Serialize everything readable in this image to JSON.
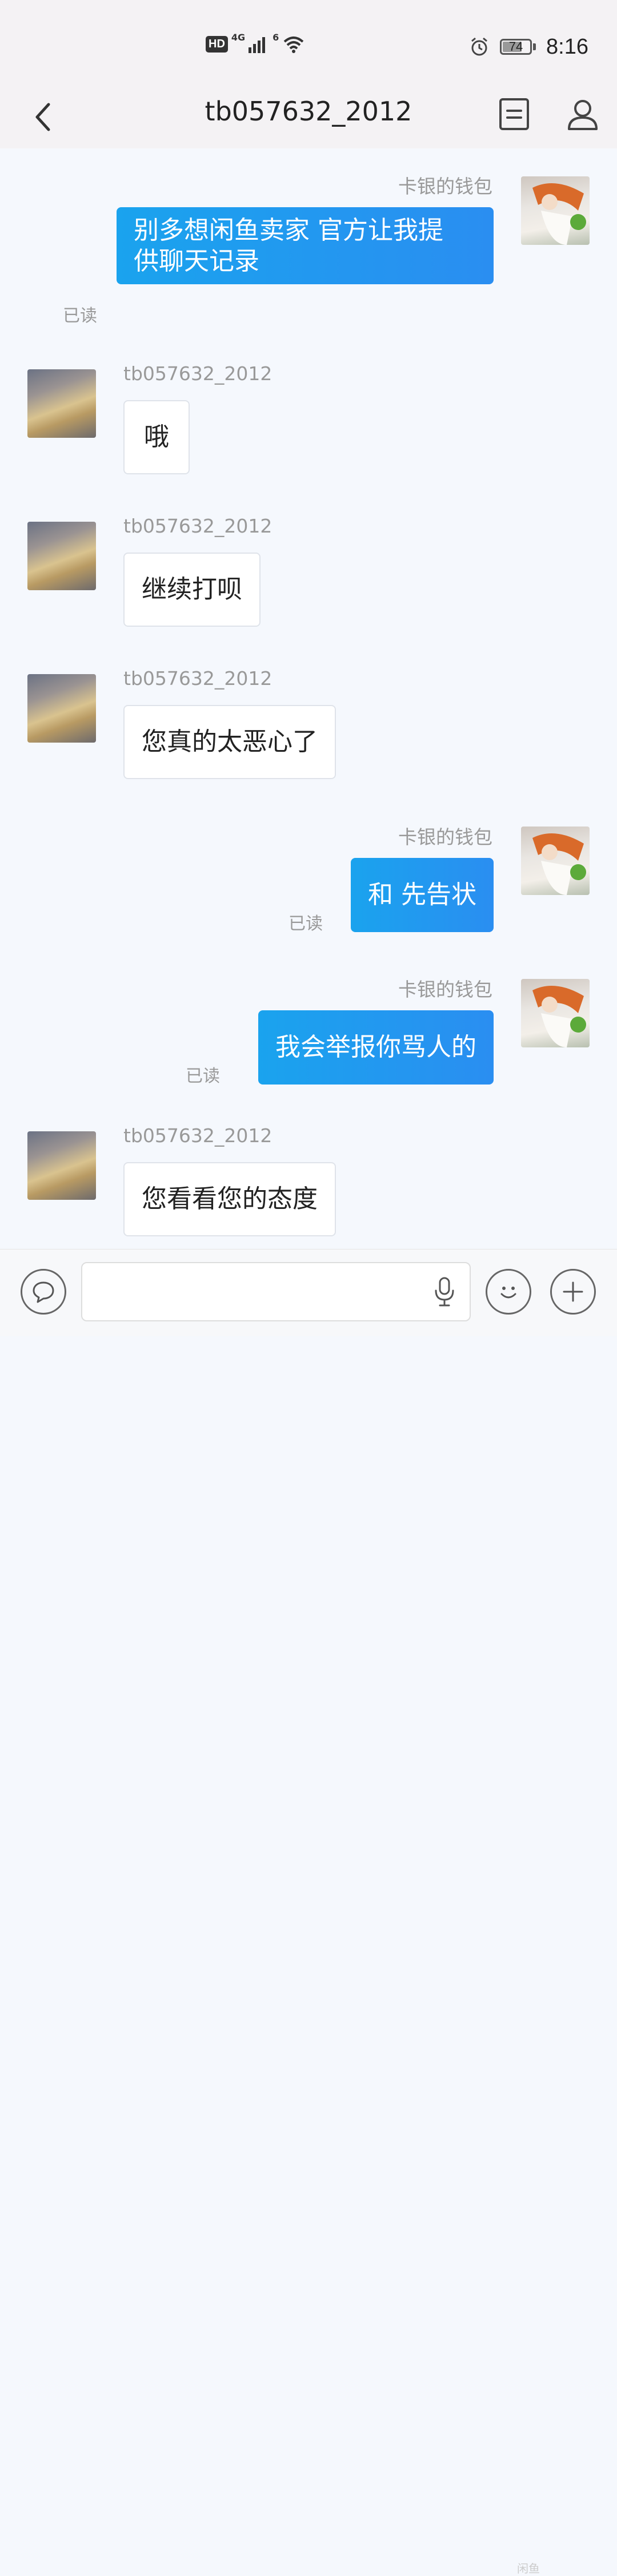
{
  "status_bar": {
    "network_badge": "HD",
    "network_type": "4G",
    "wifi_label": "6",
    "battery": "74",
    "battery_level": 0.74,
    "time": "8:16"
  },
  "header": {
    "title": "tb057632_2012"
  },
  "messages": [
    {
      "direction": "out",
      "sender": "卡银的钱包",
      "text_line1": "别多想闲鱼卖家 官方让我提",
      "text_line2": "供聊天记录",
      "read": "已读"
    },
    {
      "direction": "in",
      "sender": "tb057632_2012",
      "text": "哦"
    },
    {
      "direction": "in",
      "sender": "tb057632_2012",
      "text": "继续打呗"
    },
    {
      "direction": "in",
      "sender": "tb057632_2012",
      "text": "您真的太恶心了"
    },
    {
      "direction": "out",
      "sender": "卡银的钱包",
      "text": "和 先告状",
      "read": "已读"
    },
    {
      "direction": "out",
      "sender": "卡银的钱包",
      "text": "我会举报你骂人的",
      "read": "已读"
    },
    {
      "direction": "in",
      "sender": "tb057632_2012",
      "text": "您看看您的态度"
    }
  ],
  "input": {
    "placeholder": ""
  },
  "icons": {
    "back": "back-chevron-icon",
    "notes": "document-icon",
    "profile": "person-icon",
    "chat_toggle": "speech-bubble-icon",
    "mic": "microphone-icon",
    "emoji": "smiley-icon",
    "plus": "plus-icon"
  },
  "colors": {
    "outgoing_bubble": "#1a9cee",
    "incoming_bubble": "#ffffff",
    "background": "#f5f8fd",
    "header_bg": "#f4f2f4"
  },
  "watermark": "闲鱼"
}
